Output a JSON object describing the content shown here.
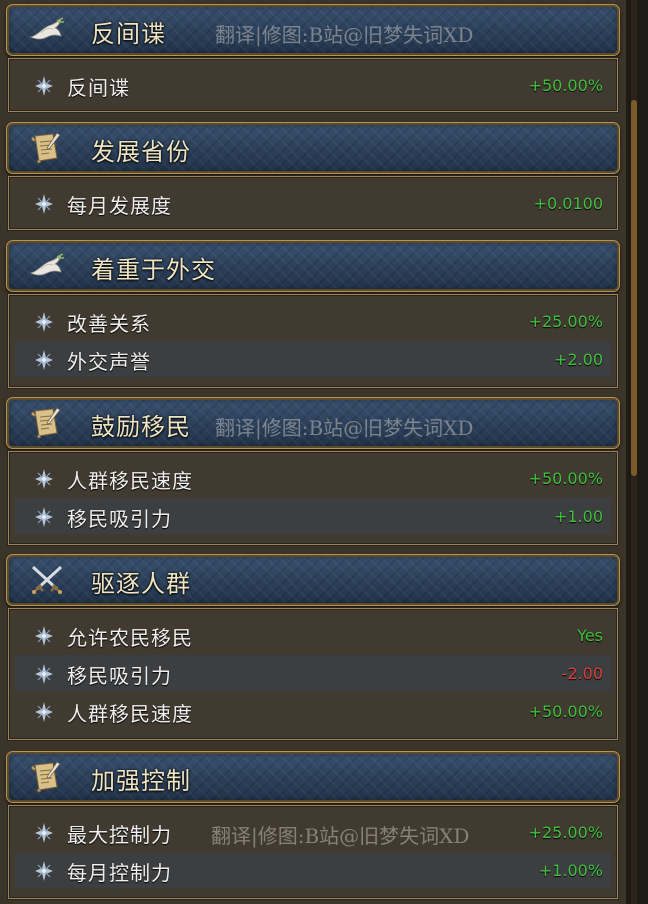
{
  "sections": [
    {
      "icon": "dove-icon",
      "title": "反间谍",
      "watermark": "翻译|修图:B站@旧梦失词XD",
      "rows": [
        {
          "label": "反间谍",
          "value": "+50.00%"
        }
      ]
    },
    {
      "icon": "scroll-icon",
      "title": "发展省份",
      "rows": [
        {
          "label": "每月发展度",
          "value": "+0.0100"
        }
      ]
    },
    {
      "icon": "dove-icon",
      "title": "着重于外交",
      "rows": [
        {
          "label": "改善关系",
          "value": "+25.00%"
        },
        {
          "label": "外交声誉",
          "value": "+2.00"
        }
      ]
    },
    {
      "icon": "scroll-icon",
      "title": "鼓励移民",
      "watermark": "翻译|修图:B站@旧梦失词XD",
      "rows": [
        {
          "label": "人群移民速度",
          "value": "+50.00%"
        },
        {
          "label": "移民吸引力",
          "value": "+1.00"
        }
      ]
    },
    {
      "icon": "crossed-swords-icon",
      "title": "驱逐人群",
      "rows": [
        {
          "label": "允许农民移民",
          "value": "Yes"
        },
        {
          "label": "移民吸引力",
          "value": "-2.00"
        },
        {
          "label": "人群移民速度",
          "value": "+50.00%"
        }
      ]
    },
    {
      "icon": "scroll-icon",
      "title": "加强控制",
      "rows": [
        {
          "label": "最大控制力",
          "value": "+25.00%",
          "watermark": "翻译|修图:B站@旧梦失词XD"
        },
        {
          "label": "每月控制力",
          "value": "+1.00%"
        }
      ]
    }
  ],
  "colors": {
    "positive": "#3fbf3c",
    "negative": "#d6403a",
    "header_bg": "#2b3f59",
    "gold_border": "#b8954e"
  }
}
